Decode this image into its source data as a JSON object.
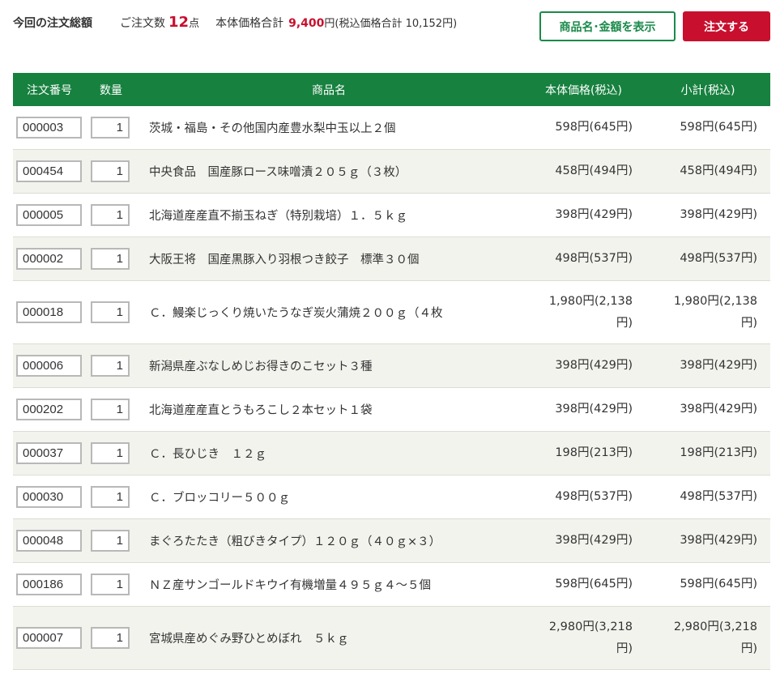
{
  "summary": {
    "title": "今回の注文総額",
    "count_label": "ご注文数",
    "count_value": "12",
    "count_unit": "点",
    "price_label": "本体価格合計",
    "price_value": "9,400",
    "price_tail": "円(税込価格合計 10,152円)"
  },
  "buttons": {
    "show_label": "商品名･金額を表示",
    "order_label": "注文する"
  },
  "colors": {
    "header_green": "#17813f",
    "accent_red": "#c8102e",
    "button_green": "#1a8a4a"
  },
  "table": {
    "columns": [
      "注文番号",
      "数量",
      "商品名",
      "本体価格(税込)",
      "小計(税込)"
    ],
    "rows": [
      {
        "no": "000003",
        "qty": "1",
        "name": "茨城・福島・その他国内産豊水梨中玉以上２個",
        "price": "598円(645円)",
        "subtotal": "598円(645円)"
      },
      {
        "no": "000454",
        "qty": "1",
        "name": "中央食品　国産豚ロース味噌漬２０５ｇ（３枚）",
        "price": "458円(494円)",
        "subtotal": "458円(494円)"
      },
      {
        "no": "000005",
        "qty": "1",
        "name": "北海道産産直不揃玉ねぎ（特別栽培）１．５ｋｇ",
        "price": "398円(429円)",
        "subtotal": "398円(429円)"
      },
      {
        "no": "000002",
        "qty": "1",
        "name": "大阪王将　国産黒豚入り羽根つき餃子　標準３０個",
        "price": "498円(537円)",
        "subtotal": "498円(537円)"
      },
      {
        "no": "000018",
        "qty": "1",
        "name": "Ｃ．鰻楽じっくり焼いたうなぎ炭火蒲焼２００ｇ（４枚",
        "price": "1,980円(2,138円)",
        "subtotal": "1,980円(2,138円)"
      },
      {
        "no": "000006",
        "qty": "1",
        "name": "新潟県産ぶなしめじお得きのこセット３種",
        "price": "398円(429円)",
        "subtotal": "398円(429円)"
      },
      {
        "no": "000202",
        "qty": "1",
        "name": "北海道産産直とうもろこし２本セット１袋",
        "price": "398円(429円)",
        "subtotal": "398円(429円)"
      },
      {
        "no": "000037",
        "qty": "1",
        "name": "Ｃ．長ひじき　１２ｇ",
        "price": "198円(213円)",
        "subtotal": "198円(213円)"
      },
      {
        "no": "000030",
        "qty": "1",
        "name": "Ｃ．ブロッコリー５００ｇ",
        "price": "498円(537円)",
        "subtotal": "498円(537円)"
      },
      {
        "no": "000048",
        "qty": "1",
        "name": "まぐろたたき（粗びきタイプ）１２０ｇ（４０ｇ×３）",
        "price": "398円(429円)",
        "subtotal": "398円(429円)"
      },
      {
        "no": "000186",
        "qty": "1",
        "name": "ＮＺ産サンゴールドキウイ有機増量４９５ｇ４～５個",
        "price": "598円(645円)",
        "subtotal": "598円(645円)"
      },
      {
        "no": "000007",
        "qty": "1",
        "name": "宮城県産めぐみ野ひとめぼれ　５ｋｇ",
        "price": "2,980円(3,218円)",
        "subtotal": "2,980円(3,218円)"
      }
    ]
  }
}
